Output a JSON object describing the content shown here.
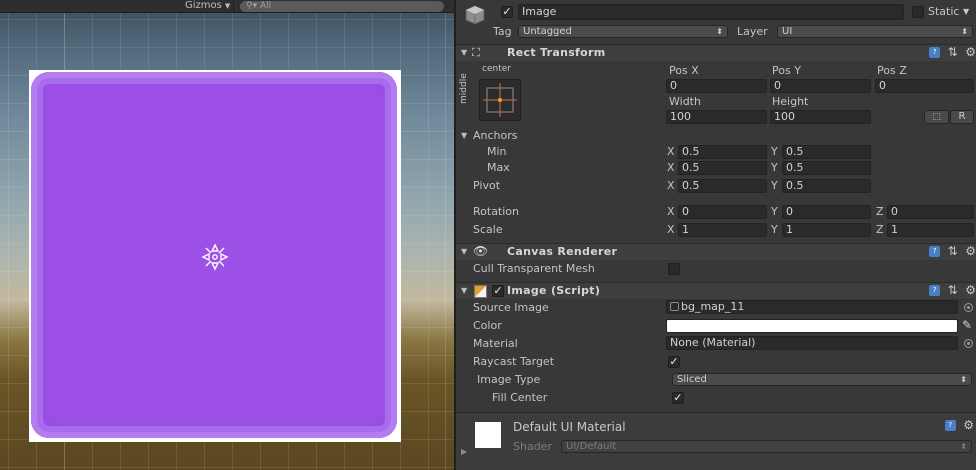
{
  "scene": {
    "gizmos_label": "Gizmos",
    "search_placeholder": "All",
    "colors": {
      "sprite_fill": "#9d50e6",
      "rect_background": "#ffffff"
    }
  },
  "inspector": {
    "object": {
      "active": true,
      "name": "Image",
      "static_label": "Static",
      "tag_label": "Tag",
      "tag_value": "Untagged",
      "layer_label": "Layer",
      "layer_value": "UI"
    },
    "rect_transform": {
      "title": "Rect Transform",
      "anchor_h_label": "center",
      "anchor_v_label": "middle",
      "pos_x_label": "Pos X",
      "pos_x": "0",
      "pos_y_label": "Pos Y",
      "pos_y": "0",
      "pos_z_label": "Pos Z",
      "pos_z": "0",
      "width_label": "Width",
      "width": "100",
      "height_label": "Height",
      "height": "100",
      "blueprint_button": "⬚",
      "raw_button": "R",
      "anchors_label": "Anchors",
      "min_label": "Min",
      "min_x": "0.5",
      "min_y": "0.5",
      "max_label": "Max",
      "max_x": "0.5",
      "max_y": "0.5",
      "pivot_label": "Pivot",
      "pivot_x": "0.5",
      "pivot_y": "0.5",
      "rotation_label": "Rotation",
      "rotation_x": "0",
      "rotation_y": "0",
      "rotation_z": "0",
      "scale_label": "Scale",
      "scale_x": "1",
      "scale_y": "1",
      "scale_z": "1",
      "x_axis": "X",
      "y_axis": "Y",
      "z_axis": "Z"
    },
    "canvas_renderer": {
      "title": "Canvas Renderer",
      "cull_label": "Cull Transparent Mesh",
      "cull_checked": false
    },
    "image_script": {
      "title": "Image (Script)",
      "enabled": true,
      "source_image_label": "Source Image",
      "source_image_value": "bg_map_11",
      "color_label": "Color",
      "color_value": "#ffffff",
      "material_label": "Material",
      "material_value": "None (Material)",
      "raycast_label": "Raycast Target",
      "raycast_checked": true,
      "image_type_label": "Image Type",
      "image_type_value": "Sliced",
      "fill_center_label": "Fill Center",
      "fill_center_checked": true
    },
    "material_preview": {
      "title": "Default UI Material",
      "shader_label": "Shader",
      "shader_value": "UI/Default"
    }
  }
}
